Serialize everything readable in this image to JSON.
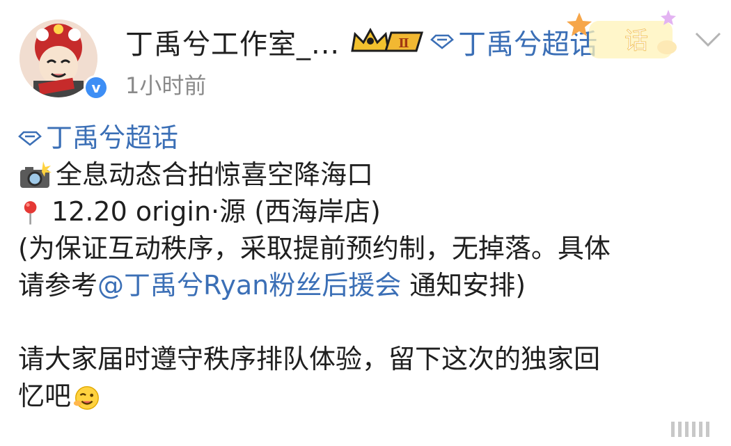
{
  "header": {
    "username": "丁禹兮工作室_...",
    "level_badge": "Ⅱ",
    "topic": "丁禹兮超话",
    "super_badge_text": "话",
    "timestamp": "1小时前"
  },
  "post": {
    "topic_tag": "丁禹兮超话",
    "lines": [
      "全息动态合拍惊喜空降海口",
      "12.20 origin·源 (西海岸店)",
      "(为保证互动秩序，采取提前预约制，无掉落。具体"
    ],
    "line4_prefix": "请参考",
    "mention": "@丁禹兮Ryan粉丝后援会",
    "line4_suffix": " 通知安排)",
    "line5": "请大家届时遵守秩序排队体验，留下这次的独家回",
    "line6": "忆吧"
  },
  "icons": {
    "camera": "camera-flash-emoji",
    "pin": "pushpin-emoji",
    "diamond": "diamond-icon",
    "wink": "wink-emoji",
    "more": "more-icon"
  },
  "colors": {
    "link": "#3b6fb6",
    "text": "#1f1f1f",
    "muted": "#8a8a8a",
    "verified": "#3d8ef5"
  }
}
